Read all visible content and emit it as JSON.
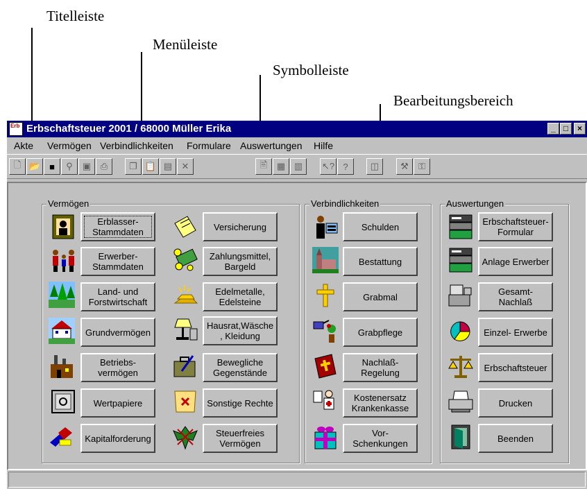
{
  "callouts": {
    "titelleiste": "Titelleiste",
    "menueleiste": "Menüleiste",
    "symbolleiste": "Symbolleiste",
    "bearbeitungsbereich": "Bearbeitungsbereich"
  },
  "window": {
    "icon_text": "Erb",
    "title": "Erbschaftsteuer 2001 / 68000 Müller Erika"
  },
  "menu": [
    "Akte",
    "Vermögen",
    "Verbindlichkeiten",
    "Formulare",
    "Auswertungen",
    "Hilfe"
  ],
  "groups": {
    "vermoegen": "Vermögen",
    "verbindlichkeiten": "Verbindlichkeiten",
    "auswertungen": "Auswertungen"
  },
  "buttons": {
    "erblasser": "Erblasser-\nStammdaten",
    "erwerber": "Erwerber-\nStammdaten",
    "land": "Land- und\nForstwirtschaft",
    "grund": "Grundvermögen",
    "betrieb": "Betriebs-\nvermögen",
    "wertpapiere": "Wertpapiere",
    "kapital": "Kapitalforderung",
    "versicherung": "Versicherung",
    "zahlungsmittel": "Zahlungsmittel,\nBargeld",
    "edelmetalle": "Edelmetalle,\nEdelsteine",
    "hausrat": "Hausrat,Wäsche\n, Kleidung",
    "beweglich": "Bewegliche\nGegenstände",
    "sonstige": "Sonstige Rechte",
    "steuerfrei": "Steuerfreies\nVermögen",
    "schulden": "Schulden",
    "bestattung": "Bestattung",
    "grabmal": "Grabmal",
    "grabpflege": "Grabpflege",
    "nachlass": "Nachlaß-\nRegelung",
    "kostenersatz": "Kostenersatz\nKrankenkasse",
    "vorschenkungen": "Vor-\nSchenkungen",
    "formular": "Erbschaftsteuer-\nFormular",
    "anlage": "Anlage Erwerber",
    "gesamt": "Gesamt-\nNachlaß",
    "einzel": "Einzel- Erwerbe",
    "erbschaftsteuer": "Erbschaftsteuer",
    "drucken": "Drucken",
    "beenden": "Beenden"
  },
  "colors": {
    "titlebar": "#000080",
    "face": "#c0c0c0"
  }
}
